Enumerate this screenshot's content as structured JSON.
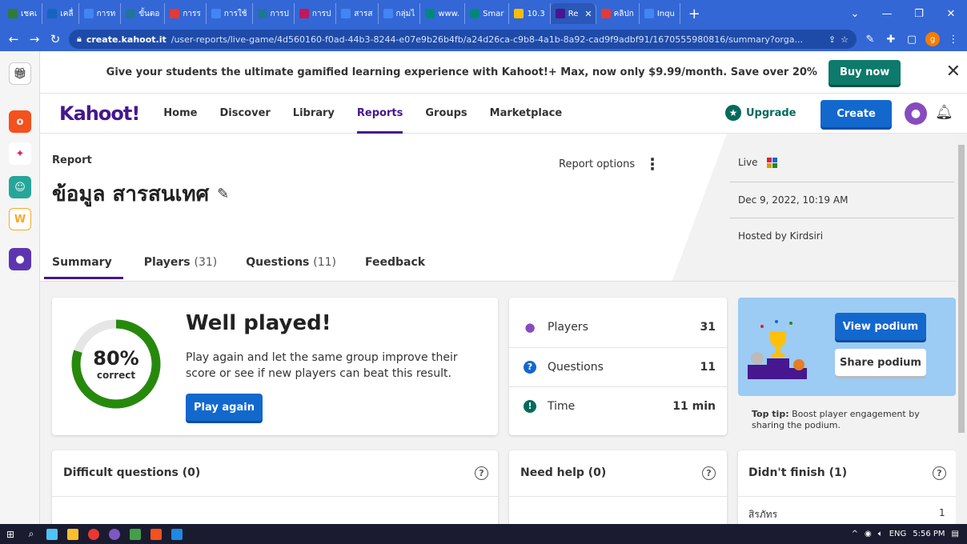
{
  "browser": {
    "tabs": [
      {
        "label": "เชคเ",
        "color": "#2e7d32"
      },
      {
        "label": "เคลื่",
        "color": "#1565c0"
      },
      {
        "label": "การท",
        "color": "#4285f4"
      },
      {
        "label": "ขั้นตอ",
        "color": "#21759b"
      },
      {
        "label": "การร",
        "color": "#e53935"
      },
      {
        "label": "การใช้",
        "color": "#4285f4"
      },
      {
        "label": "การป",
        "color": "#21759b"
      },
      {
        "label": "การป",
        "color": "#c2185b"
      },
      {
        "label": "สารส",
        "color": "#4285f4"
      },
      {
        "label": "กลุ่มไ",
        "color": "#4285f4"
      },
      {
        "label": "www.",
        "color": "#00897b"
      },
      {
        "label": "Smar",
        "color": "#00897b"
      },
      {
        "label": "10.3",
        "color": "#fbbc04"
      },
      {
        "label": "Re",
        "color": "#46178f",
        "active": true
      },
      {
        "label": "คลิปก",
        "color": "#e53935"
      },
      {
        "label": "Inqu",
        "color": "#4285f4"
      }
    ],
    "url_host": "create.kahoot.it",
    "url_path": "/user-reports/live-game/4d560160-f0ad-44b3-8244-e07e9b26b4fb/a24d26ca-c9b8-4a1b-8a92-cad9f9adbf91/1670555980816/summary?orga...",
    "profile_letter": "g"
  },
  "promo": {
    "text": "Give your students the ultimate gamified learning experience with Kahoot!+ Max, now only $9.99/month. Save over 20%",
    "button": "Buy now"
  },
  "nav": {
    "logo": "Kahoot!",
    "links": [
      "Home",
      "Discover",
      "Library",
      "Reports",
      "Groups",
      "Marketplace"
    ],
    "active": "Reports",
    "upgrade": "Upgrade",
    "create": "Create"
  },
  "report": {
    "label": "Report",
    "title": "ข้อมูล สารสนเทศ",
    "options": "Report options",
    "tabs": [
      {
        "label": "Summary",
        "count": ""
      },
      {
        "label": "Players",
        "count": "(31)"
      },
      {
        "label": "Questions",
        "count": "(11)"
      },
      {
        "label": "Feedback",
        "count": ""
      }
    ],
    "live": "Live",
    "date": "Dec 9, 2022, 10:19 AM",
    "hosted": "Hosted by Kirdsiri"
  },
  "summary": {
    "percent_value": 80,
    "percent": "80%",
    "correct": "correct",
    "heading": "Well played!",
    "description": "Play again and let the same group improve their score or see if new players can beat this result.",
    "play_again": "Play again"
  },
  "stats": [
    {
      "label": "Players",
      "value": "31",
      "icon": "person-icon",
      "color": "#864cbf"
    },
    {
      "label": "Questions",
      "value": "11",
      "icon": "question-icon",
      "color": "#1368ce"
    },
    {
      "label": "Time",
      "value": "11 min",
      "icon": "clock-icon",
      "color": "#046a5c"
    }
  ],
  "podium": {
    "view": "View podium",
    "share": "Share podium",
    "tip_bold": "Top tip:",
    "tip": "Boost player engagement by sharing the podium."
  },
  "bottom": {
    "difficult": "Difficult questions (0)",
    "need_help": "Need help (0)",
    "didnt_finish": "Didn't finish (1)",
    "row_name": "สิรภัทร",
    "row_value": "1"
  },
  "taskbar": {
    "lang": "ENG",
    "time": "5:56 PM"
  },
  "colors": {
    "brand": "#46178f",
    "primary": "#1368ce",
    "teal": "#046a5c",
    "ring": "#26890c"
  }
}
